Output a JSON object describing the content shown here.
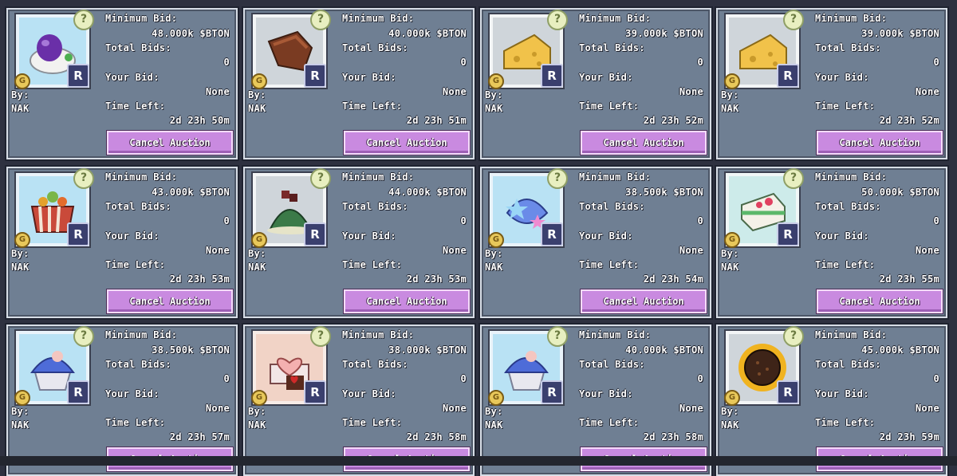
{
  "labels": {
    "min_bid": "Minimum Bid:",
    "total_bids": "Total Bids:",
    "your_bid": "Your Bid:",
    "time_left": "Time Left:",
    "by": "By:",
    "cancel": "Cancel Auction",
    "question_badge": "?",
    "gold_badge": "G",
    "rarity_badge": "R"
  },
  "listings": [
    {
      "item_icon": "purple-egg-dish-icon",
      "min_bid": "48.000k $BTON",
      "total_bids": "0",
      "your_bid": "None",
      "seller": "NAK",
      "time_left": "2d 23h 50m"
    },
    {
      "item_icon": "roast-meat-icon",
      "min_bid": "40.000k $BTON",
      "total_bids": "0",
      "your_bid": "None",
      "seller": "NAK",
      "time_left": "2d 23h 51m"
    },
    {
      "item_icon": "cheese-wedge-icon",
      "min_bid": "39.000k $BTON",
      "total_bids": "0",
      "your_bid": "None",
      "seller": "NAK",
      "time_left": "2d 23h 52m"
    },
    {
      "item_icon": "cheese-wedge-icon",
      "min_bid": "39.000k $BTON",
      "total_bids": "0",
      "your_bid": "None",
      "seller": "NAK",
      "time_left": "2d 23h 52m"
    },
    {
      "item_icon": "fruit-cup-icon",
      "min_bid": "43.000k $BTON",
      "total_bids": "0",
      "your_bid": "None",
      "seller": "NAK",
      "time_left": "2d 23h 53m"
    },
    {
      "item_icon": "matcha-cake-icon",
      "min_bid": "44.000k $BTON",
      "total_bids": "0",
      "your_bid": "None",
      "seller": "NAK",
      "time_left": "2d 23h 53m"
    },
    {
      "item_icon": "star-cream-dessert-icon",
      "min_bid": "38.500k $BTON",
      "total_bids": "0",
      "your_bid": "None",
      "seller": "NAK",
      "time_left": "2d 23h 54m"
    },
    {
      "item_icon": "strawberry-cake-slice-icon",
      "min_bid": "50.000k $BTON",
      "total_bids": "0",
      "your_bid": "None",
      "seller": "NAK",
      "time_left": "2d 23h 55m"
    },
    {
      "item_icon": "blue-cupcake-icon",
      "min_bid": "38.500k $BTON",
      "total_bids": "0",
      "your_bid": "None",
      "seller": "NAK",
      "time_left": "2d 23h 57m"
    },
    {
      "item_icon": "heart-chocolate-cake-icon",
      "min_bid": "38.000k $BTON",
      "total_bids": "0",
      "your_bid": "None",
      "seller": "NAK",
      "time_left": "2d 23h 58m"
    },
    {
      "item_icon": "blue-cupcake-icon",
      "min_bid": "40.000k $BTON",
      "total_bids": "0",
      "your_bid": "None",
      "seller": "NAK",
      "time_left": "2d 23h 58m"
    },
    {
      "item_icon": "sunflower-cookie-icon",
      "min_bid": "45.000k $BTON",
      "total_bids": "0",
      "your_bid": "None",
      "seller": "NAK",
      "time_left": "2d 23h 59m"
    }
  ]
}
